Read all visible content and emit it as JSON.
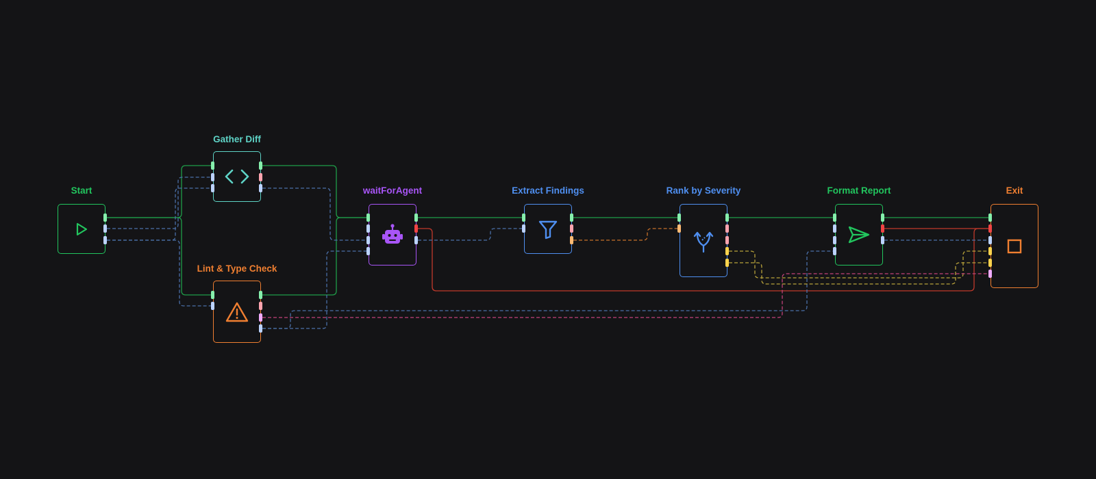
{
  "colors": {
    "background": "#141416",
    "green": "#22c55e",
    "teal": "#5ed3c6",
    "orange": "#f07f31",
    "purple": "#a855f7",
    "blue": "#4f8ff0",
    "port_green": "#86efac",
    "port_blue": "#bcd3ff",
    "port_pink": "#fda4af",
    "port_red": "#ef4444",
    "port_orange": "#fdba74",
    "port_yellow": "#fcd34d",
    "port_magenta": "#f0abfc",
    "edge_green": "#1f9d49",
    "edge_blue": "#4a6fa8",
    "edge_red": "#c0392b",
    "edge_orange": "#c8702a",
    "edge_yellow": "#b8a23a",
    "edge_magenta": "#c2417a"
  },
  "nodes": [
    {
      "id": "start",
      "label": "Start",
      "icon": "play-icon",
      "color_key": "green"
    },
    {
      "id": "gather",
      "label": "Gather Diff",
      "icon": "code-icon",
      "color_key": "teal"
    },
    {
      "id": "lint",
      "label": "Lint & Type Check",
      "icon": "warning-icon",
      "color_key": "orange"
    },
    {
      "id": "wait",
      "label": "waitForAgent",
      "icon": "robot-icon",
      "color_key": "purple"
    },
    {
      "id": "extract",
      "label": "Extract Findings",
      "icon": "filter-icon",
      "color_key": "blue"
    },
    {
      "id": "rank",
      "label": "Rank by Severity",
      "icon": "split-icon",
      "color_key": "blue"
    },
    {
      "id": "format",
      "label": "Format Report",
      "icon": "send-icon",
      "color_key": "green"
    },
    {
      "id": "exit",
      "label": "Exit",
      "icon": "stop-icon",
      "color_key": "orange"
    }
  ]
}
